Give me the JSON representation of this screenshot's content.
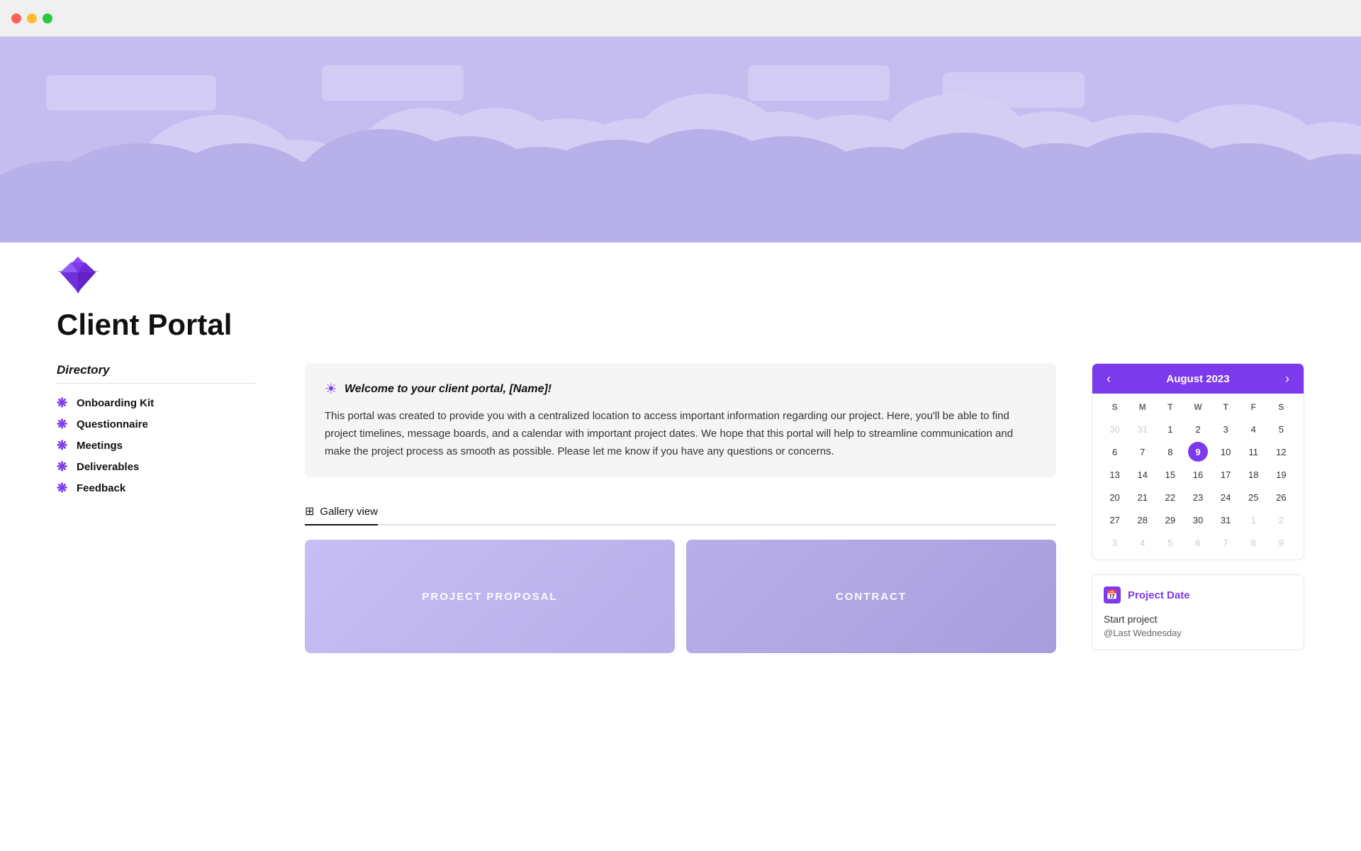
{
  "browser": {
    "traffic_lights": [
      "red",
      "yellow",
      "green"
    ]
  },
  "banner": {
    "bg_color": "#c5bdf0"
  },
  "logo": {
    "aria": "diamond-logo"
  },
  "page": {
    "title": "Client Portal"
  },
  "welcome": {
    "icon": "☀",
    "heading": "Welcome to your client portal, [Name]!",
    "body": "This portal was created to provide you with a centralized location to access important information regarding our project. Here, you'll be able to find project timelines, message boards, and a calendar with important project dates. We hope that this portal will help to streamline communication and make the project process as smooth as possible. Please let me know if you have any questions or concerns."
  },
  "gallery": {
    "tab_label": "Gallery view",
    "cards": [
      {
        "id": "proposal",
        "label": "PROJECT PROPOSAL"
      },
      {
        "id": "contract",
        "label": "CONTRACT"
      }
    ]
  },
  "sidebar": {
    "title": "Directory",
    "items": [
      {
        "label": "Onboarding Kit"
      },
      {
        "label": "Questionnaire"
      },
      {
        "label": "Meetings"
      },
      {
        "label": "Deliverables"
      },
      {
        "label": "Feedback"
      }
    ]
  },
  "calendar": {
    "prev_label": "‹",
    "next_label": "›",
    "month_year": "August 2023",
    "day_headers": [
      "S",
      "M",
      "T",
      "W",
      "T",
      "F",
      "S"
    ],
    "weeks": [
      [
        {
          "d": "30",
          "m": "prev"
        },
        {
          "d": "31",
          "m": "prev"
        },
        {
          "d": "1",
          "m": "cur"
        },
        {
          "d": "2",
          "m": "cur"
        },
        {
          "d": "3",
          "m": "cur"
        },
        {
          "d": "4",
          "m": "cur"
        },
        {
          "d": "5",
          "m": "cur"
        }
      ],
      [
        {
          "d": "6",
          "m": "cur"
        },
        {
          "d": "7",
          "m": "cur"
        },
        {
          "d": "8",
          "m": "cur"
        },
        {
          "d": "9",
          "m": "cur",
          "today": true
        },
        {
          "d": "10",
          "m": "cur"
        },
        {
          "d": "11",
          "m": "cur"
        },
        {
          "d": "12",
          "m": "cur"
        }
      ],
      [
        {
          "d": "13",
          "m": "cur"
        },
        {
          "d": "14",
          "m": "cur"
        },
        {
          "d": "15",
          "m": "cur"
        },
        {
          "d": "16",
          "m": "cur"
        },
        {
          "d": "17",
          "m": "cur"
        },
        {
          "d": "18",
          "m": "cur"
        },
        {
          "d": "19",
          "m": "cur"
        }
      ],
      [
        {
          "d": "20",
          "m": "cur"
        },
        {
          "d": "21",
          "m": "cur"
        },
        {
          "d": "22",
          "m": "cur"
        },
        {
          "d": "23",
          "m": "cur"
        },
        {
          "d": "24",
          "m": "cur"
        },
        {
          "d": "25",
          "m": "cur"
        },
        {
          "d": "26",
          "m": "cur"
        }
      ],
      [
        {
          "d": "27",
          "m": "cur"
        },
        {
          "d": "28",
          "m": "cur"
        },
        {
          "d": "29",
          "m": "cur"
        },
        {
          "d": "30",
          "m": "cur"
        },
        {
          "d": "31",
          "m": "cur"
        },
        {
          "d": "1",
          "m": "next"
        },
        {
          "d": "2",
          "m": "next"
        }
      ],
      [
        {
          "d": "3",
          "m": "next"
        },
        {
          "d": "4",
          "m": "next"
        },
        {
          "d": "5",
          "m": "next"
        },
        {
          "d": "6",
          "m": "next"
        },
        {
          "d": "7",
          "m": "next"
        },
        {
          "d": "8",
          "m": "next"
        },
        {
          "d": "9",
          "m": "next"
        }
      ]
    ]
  },
  "project_date": {
    "icon": "📅",
    "title": "Project Date",
    "start_label": "Start project",
    "sub_label": "@Last Wednesday"
  }
}
